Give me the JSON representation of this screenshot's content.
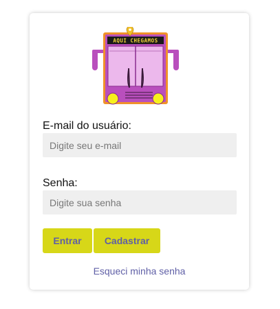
{
  "logo": {
    "banner_text": "AQUI CHEGAMOS",
    "colors": {
      "body": "#b94fbd",
      "window": "#ecb8ec",
      "frame": "#f0922a",
      "banner": "#1a1a1a",
      "banner_text": "#f3d53a",
      "headlight": "#f7f01c",
      "pin": "#f0c02a"
    }
  },
  "form": {
    "email_label": "E-mail do usuário:",
    "email_placeholder": "Digite seu e-mail",
    "email_value": "",
    "password_label": "Senha:",
    "password_placeholder": "Digite sua senha",
    "password_value": "",
    "login_button": "Entrar",
    "register_button": "Cadastrar",
    "forgot_link": "Esqueci minha senha"
  },
  "colors": {
    "button_bg": "#d7d718",
    "button_text": "#5f5fa6",
    "link": "#5f5fa6",
    "input_bg": "#efefef"
  }
}
